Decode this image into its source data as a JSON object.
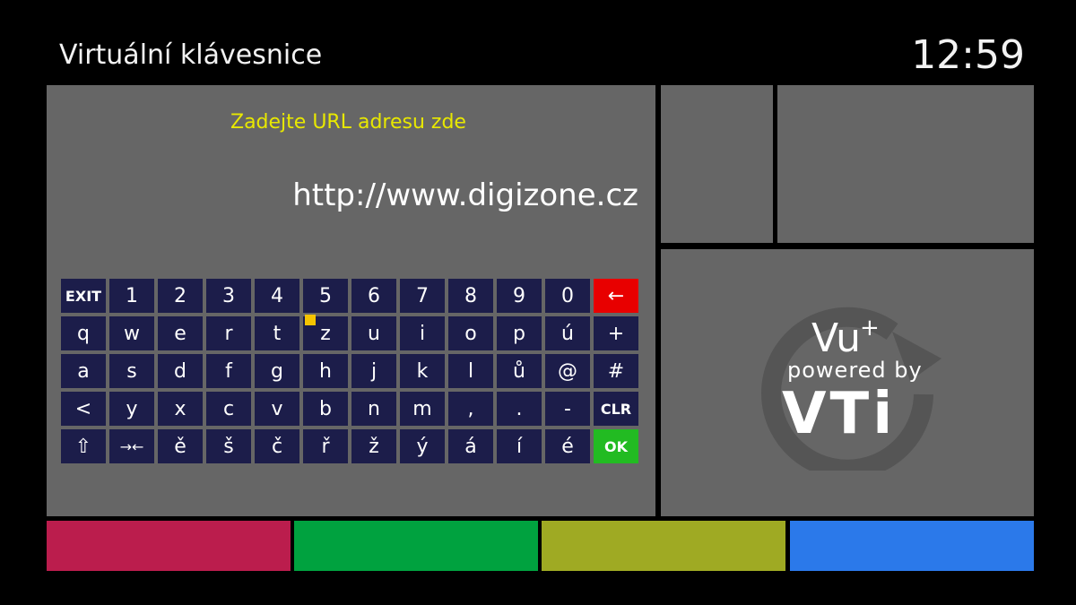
{
  "header": {
    "title": "Virtuální klávesnice",
    "clock": "12:59"
  },
  "input": {
    "prompt": "Zadejte URL adresu zde",
    "value": "http://www.digizone.cz"
  },
  "keyboard": {
    "rows": [
      [
        "EXIT",
        "1",
        "2",
        "3",
        "4",
        "5",
        "6",
        "7",
        "8",
        "9",
        "0",
        "←"
      ],
      [
        "q",
        "w",
        "e",
        "r",
        "t",
        "z",
        "u",
        "i",
        "o",
        "p",
        "ú",
        "+"
      ],
      [
        "a",
        "s",
        "d",
        "f",
        "g",
        "h",
        "j",
        "k",
        "l",
        "ů",
        "@",
        "#"
      ],
      [
        "<",
        "y",
        "x",
        "c",
        "v",
        "b",
        "n",
        "m",
        ",",
        ".",
        "-",
        "CLR"
      ],
      [
        "⇧",
        "→←",
        "ě",
        "š",
        "č",
        "ř",
        "ž",
        "ý",
        "á",
        "í",
        "é",
        "OK"
      ]
    ],
    "focused_key": "z"
  },
  "logo": {
    "brand": "Vu",
    "plus": "+",
    "powered": "powered by",
    "vendor": "VTi"
  },
  "color_buttons": [
    {
      "name": "red",
      "color": "#bb1d4d"
    },
    {
      "name": "green",
      "color": "#00a23f"
    },
    {
      "name": "yellow",
      "color": "#9faa23"
    },
    {
      "name": "blue",
      "color": "#2b79ea"
    }
  ]
}
